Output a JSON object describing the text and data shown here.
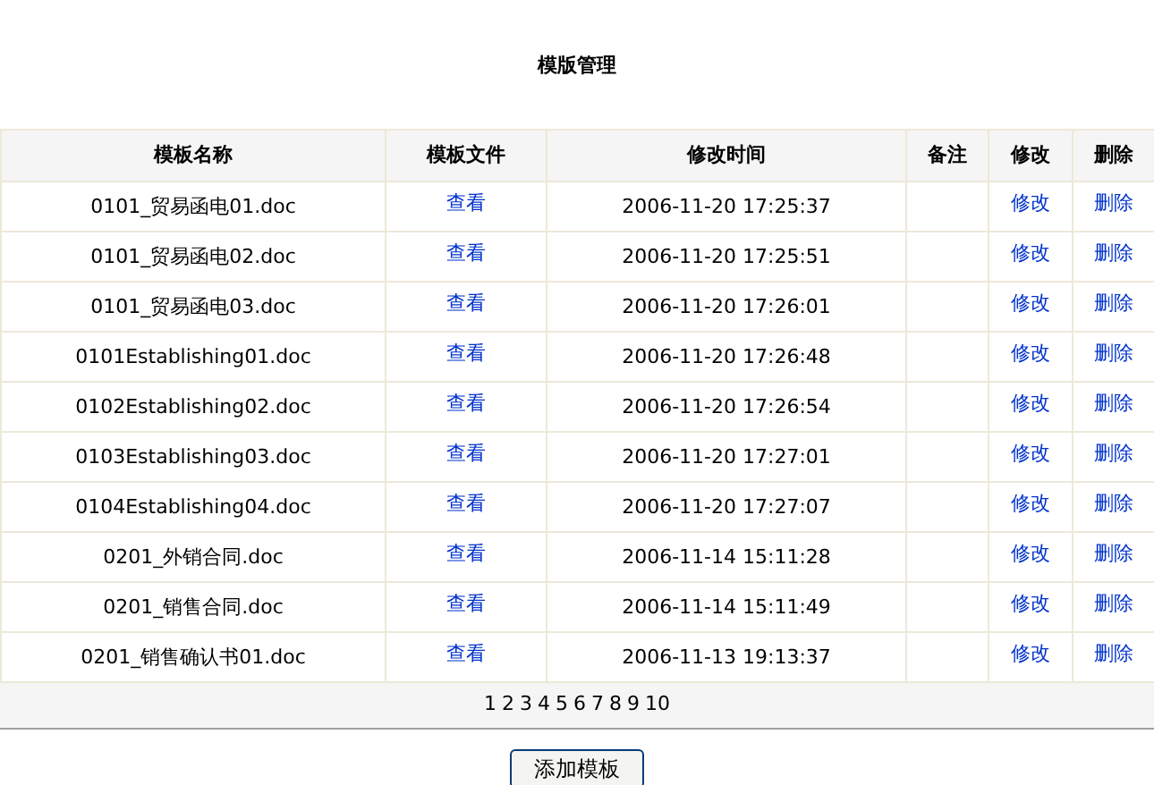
{
  "title": "模版管理",
  "table": {
    "columns": [
      "模板名称",
      "模板文件",
      "修改时间",
      "备注",
      "修改",
      "删除"
    ],
    "rows": [
      {
        "name": "0101_贸易函电01.doc",
        "file": "查看",
        "time": "2006-11-20 17:25:37",
        "edit": "修改",
        "delete": "删除"
      },
      {
        "name": "0101_贸易函电02.doc",
        "file": "查看",
        "time": "2006-11-20 17:25:51",
        "edit": "修改",
        "delete": "删除"
      },
      {
        "name": "0101_贸易函电03.doc",
        "file": "查看",
        "time": "2006-11-20 17:26:01",
        "edit": "修改",
        "delete": "删除"
      },
      {
        "name": "0101Establishing01.doc",
        "file": "查看",
        "time": "2006-11-20 17:26:48",
        "edit": "修改",
        "delete": "删除"
      },
      {
        "name": "0102Establishing02.doc",
        "file": "查看",
        "time": "2006-11-20 17:26:54",
        "edit": "修改",
        "delete": "删除"
      },
      {
        "name": "0103Establishing03.doc",
        "file": "查看",
        "time": "2006-11-20 17:27:01",
        "edit": "修改",
        "delete": "删除"
      },
      {
        "name": "0104Establishing04.doc",
        "file": "查看",
        "time": "2006-11-20 17:27:07",
        "edit": "修改",
        "delete": "删除"
      },
      {
        "name": "0201_外销合同.doc",
        "file": "查看",
        "time": "2006-11-14 15:11:28",
        "edit": "修改",
        "delete": "删除"
      },
      {
        "name": "0201_销售合同.doc",
        "file": "查看",
        "time": "2006-11-14 15:11:49",
        "edit": "修改",
        "delete": "删除"
      },
      {
        "name": "0201_销售确认书01.doc",
        "file": "查看",
        "time": "2006-11-13 19:13:37",
        "edit": "修改",
        "delete": "删除"
      }
    ]
  },
  "pagination": [
    "1",
    "2",
    "3",
    "4",
    "5",
    "6",
    "7",
    "8",
    "9",
    "10"
  ],
  "add_button": "添加模板"
}
